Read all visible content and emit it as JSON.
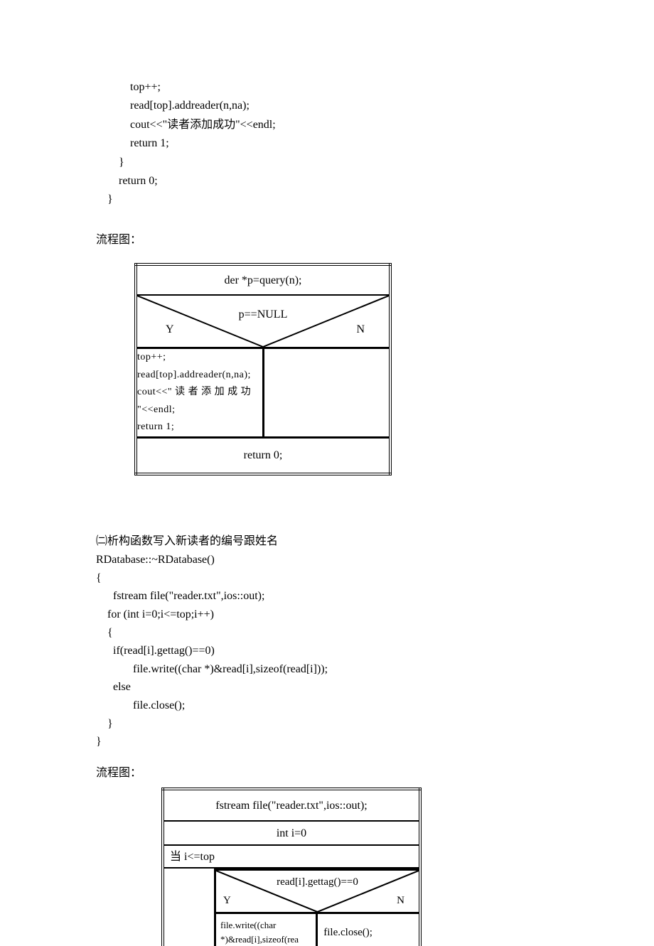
{
  "code1": {
    "l1": "            top++;",
    "l2": "            read[top].addreader(n,na);",
    "l3": "            cout<<\"读者添加成功\"<<endl;",
    "l4": "            return 1;",
    "l5": "        }",
    "l6": "        return 0;",
    "l7": "    }"
  },
  "heading1": "流程图：",
  "flow1": {
    "top": "der *p=query(n);",
    "cond": "p==NULL",
    "y": "Y",
    "n": "N",
    "branch_y_l1": "top++;",
    "branch_y_l2": "read[top].addreader(n,na);",
    "branch_y_l3": "cout<<\" 读 者 添 加 成 功",
    "branch_y_l4": "\"<<endl;",
    "branch_y_l5": "return 1;",
    "bottom": "return 0;"
  },
  "sec2": {
    "l1": "㈡析构函数写入新读者的编号跟姓名",
    "l2": "RDatabase::~RDatabase()",
    "l3": "{",
    "l4": "      fstream file(\"reader.txt\",ios::out);",
    "l5": "    for (int i=0;i<=top;i++)",
    "l6": "    {",
    "l7": "      if(read[i].gettag()==0)",
    "l8": "             file.write((char *)&read[i],sizeof(read[i]));",
    "l9": "      else",
    "l10": "             file.close();",
    "l11": "    }",
    "l12": "}"
  },
  "heading2": "流程图：",
  "flow2": {
    "top": "fstream file(\"reader.txt\",ios::out);",
    "init": "int i=0",
    "loop": "当 i<=top",
    "cond": "read[i].gettag()==0",
    "y": "Y",
    "n": "N",
    "branch_y_l1": "file.write((char",
    "branch_y_l2": "*)&read[i],sizeof(rea",
    "branch_n": "file.close();"
  }
}
